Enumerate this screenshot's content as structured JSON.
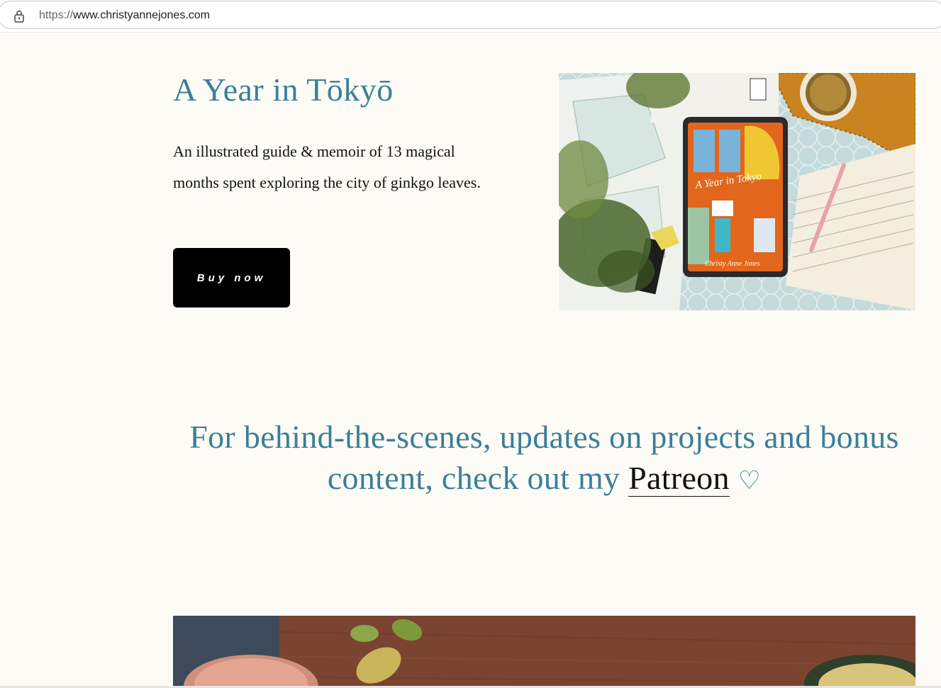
{
  "browser": {
    "url_scheme": "https://",
    "url_host": "www.christyannejones.com"
  },
  "hero": {
    "title": "A Year in Tōkyō",
    "description": "An illustrated guide & memoir of 13 magical months spent exploring the city of ginkgo leaves.",
    "buy_label": "Buy now",
    "image": {
      "book_title": "A Year in Tokyo",
      "book_author": "Christy Anne Jones"
    }
  },
  "patreon": {
    "text_before": "For behind-the-scenes, updates on projects and bonus content, check out my ",
    "link_label": "Patreon",
    "heart": "♡"
  },
  "colors": {
    "accent": "#3a7f98",
    "background": "#fdfbf6",
    "button": "#000000"
  }
}
